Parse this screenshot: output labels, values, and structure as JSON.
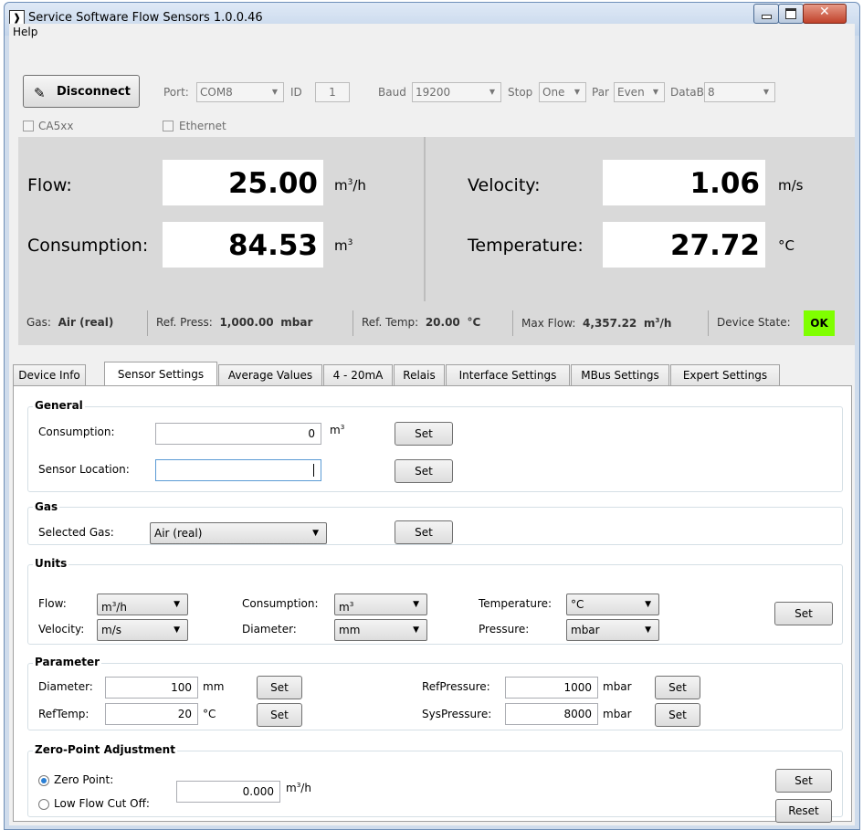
{
  "window": {
    "title": "Service Software Flow Sensors 1.0.0.46",
    "app_icon": "❱"
  },
  "menu": {
    "help": "Help"
  },
  "connection": {
    "disconnect_label": "Disconnect",
    "port_label": "Port:",
    "port_value": "COM8",
    "id_label": "ID",
    "id_value": "1",
    "baud_label": "Baud",
    "baud_value": "19200",
    "stop_label": "Stop",
    "stop_value": "One",
    "par_label": "Par",
    "par_value": "Even",
    "datab_label": "DataB",
    "datab_value": "8",
    "ca5xx_label": "CA5xx",
    "ethernet_label": "Ethernet"
  },
  "readout": {
    "flow_label": "Flow:",
    "flow_value": "25.00",
    "flow_unit": "m",
    "consumption_label": "Consumption:",
    "consumption_value": "84.53",
    "consumption_unit": "m",
    "velocity_label": "Velocity:",
    "velocity_value": "1.06",
    "velocity_unit": "m/s",
    "temperature_label": "Temperature:",
    "temperature_value": "27.72",
    "temperature_unit": "°C"
  },
  "info": {
    "gas_label": "Gas:",
    "gas_value": "Air (real)",
    "ref_press_label": "Ref. Press:",
    "ref_press_value": "1,000.00",
    "ref_press_unit": "mbar",
    "ref_temp_label": "Ref. Temp:",
    "ref_temp_value": "20.00",
    "ref_temp_unit": "°C",
    "max_flow_label": "Max Flow:",
    "max_flow_value": "4,357.22",
    "max_flow_unit": "m",
    "device_state_label": "Device State:",
    "device_state_value": "OK",
    "ok_color": "#7fff00"
  },
  "tabs": [
    "Device Info",
    "Sensor Settings",
    "Average Values",
    "4 - 20mA",
    "Relais",
    "Interface Settings",
    "MBus Settings",
    "Expert Settings"
  ],
  "general": {
    "title": "General",
    "consumption_label": "Consumption:",
    "consumption_value": "0",
    "consumption_unit": "m",
    "location_label": "Sensor Location:",
    "location_value": "",
    "set": "Set"
  },
  "gas": {
    "title": "Gas",
    "selected_label": "Selected Gas:",
    "selected_value": "Air (real)",
    "set": "Set"
  },
  "units": {
    "title": "Units",
    "flow_label": "Flow:",
    "flow_value": "m",
    "velocity_label": "Velocity:",
    "velocity_value": "m/s",
    "consumption_label": "Consumption:",
    "consumption_value": "m",
    "diameter_label": "Diameter:",
    "diameter_value": "mm",
    "temperature_label": "Temperature:",
    "temperature_value": "°C",
    "pressure_label": "Pressure:",
    "pressure_value": "mbar",
    "set": "Set"
  },
  "parameter": {
    "title": "Parameter",
    "diameter_label": "Diameter:",
    "diameter_value": "100",
    "diameter_unit": "mm",
    "reftemp_label": "RefTemp:",
    "reftemp_value": "20",
    "reftemp_unit": "°C",
    "refpressure_label": "RefPressure:",
    "refpressure_value": "1000",
    "refpressure_unit": "mbar",
    "syspressure_label": "SysPressure:",
    "syspressure_value": "8000",
    "syspressure_unit": "mbar",
    "set": "Set"
  },
  "zero_point": {
    "title": "Zero-Point Adjustment",
    "zero_point_label": "Zero Point:",
    "low_flow_label": "Low Flow Cut Off:",
    "value": "0.000",
    "unit": "m",
    "set": "Set",
    "reset": "Reset"
  }
}
